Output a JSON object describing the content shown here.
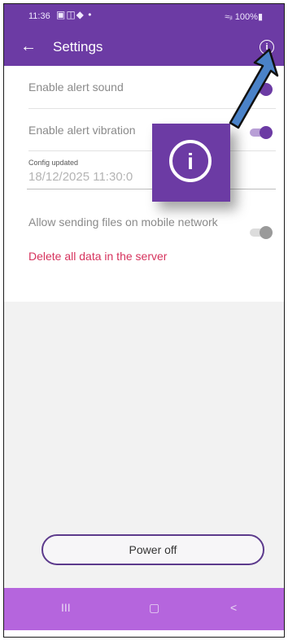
{
  "status_bar": {
    "time": "11:36",
    "indicators": "▣◫◆ •",
    "right": "≈ᵢₗ 100%▮"
  },
  "app_bar": {
    "title": "Settings",
    "back_icon": "←",
    "info_icon": "i"
  },
  "settings": {
    "alert_sound_label": "Enable alert sound",
    "alert_sound_on": true,
    "alert_vibration_label": "Enable alert vibration",
    "alert_vibration_on": true,
    "config_label": "Config updated",
    "config_value": "18/12/2025 11:30:0",
    "mobile_network_label": "Allow sending files on mobile network",
    "mobile_network_on": false,
    "delete_label": "Delete all data in the server"
  },
  "overlay": {
    "info_icon": "i",
    "arrow_color": "#4a82c8"
  },
  "footer": {
    "power_off_label": "Power off"
  },
  "nav_bar": {
    "recents": "III",
    "home": "▢",
    "back": "<"
  },
  "colors": {
    "primary": "#6c3ba4",
    "danger": "#d6335d",
    "nav": "#b565dd"
  }
}
